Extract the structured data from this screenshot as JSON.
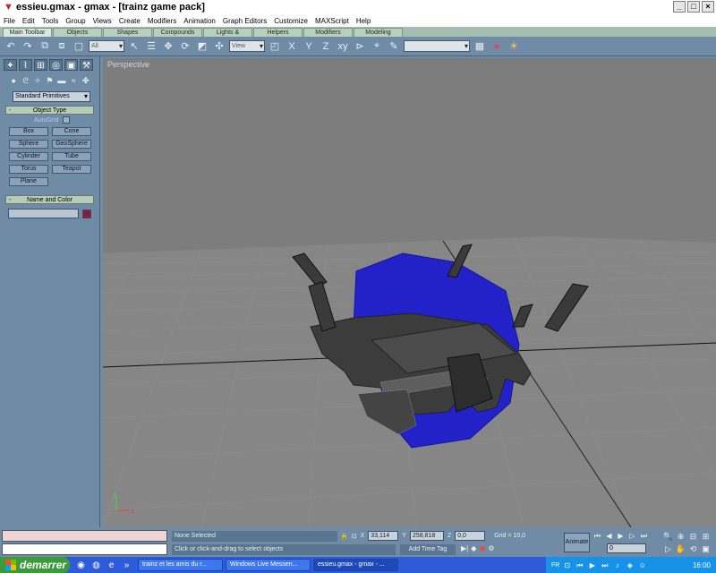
{
  "window": {
    "title": "essieu.gmax - gmax - [trainz game pack]",
    "controls": [
      "_",
      "□",
      "×"
    ]
  },
  "menu": [
    "File",
    "Edit",
    "Tools",
    "Group",
    "Views",
    "Create",
    "Modifiers",
    "Animation",
    "Graph Editors",
    "Customize",
    "MAXScript",
    "Help"
  ],
  "tabs": [
    "Main Toolbar",
    "Objects",
    "Shapes",
    "Compounds",
    "Lights & Cameras",
    "Helpers",
    "Modifiers",
    "Modeling"
  ],
  "toolbar": {
    "filter_value": "All",
    "refcoord_value": "View",
    "named_sel_value": ""
  },
  "command_panel": {
    "category_value": "Standard Primitives",
    "object_type": {
      "header": "Object Type",
      "autogrid_label": "AutoGrid",
      "buttons": [
        "Box",
        "Cone",
        "Sphere",
        "GeoSphere",
        "Cylinder",
        "Tube",
        "Torus",
        "Teapot",
        "Plane"
      ]
    },
    "name_color": {
      "header": "Name and Color",
      "name_value": "",
      "color": "#8a1a3b"
    }
  },
  "viewport": {
    "label": "Perspective"
  },
  "status": {
    "selection": "None Selected",
    "hint": "Click or click-and-drag to select objects",
    "x_label": "X",
    "x_value": "33,114",
    "y_label": "Y",
    "y_value": "258,818",
    "z_label": "Z",
    "z_value": "0,0",
    "grid": "Grid = 10,0",
    "add_time_tag": "Add Time Tag",
    "animate": "Animate",
    "frame_value": "0"
  },
  "taskbar": {
    "start": "demarrer",
    "tasks": [
      "trainz et les amis du r...",
      "Windows Live Messen...",
      "essieu.gmax - gmax - ..."
    ],
    "lang": "FR",
    "clock": "16:00"
  }
}
